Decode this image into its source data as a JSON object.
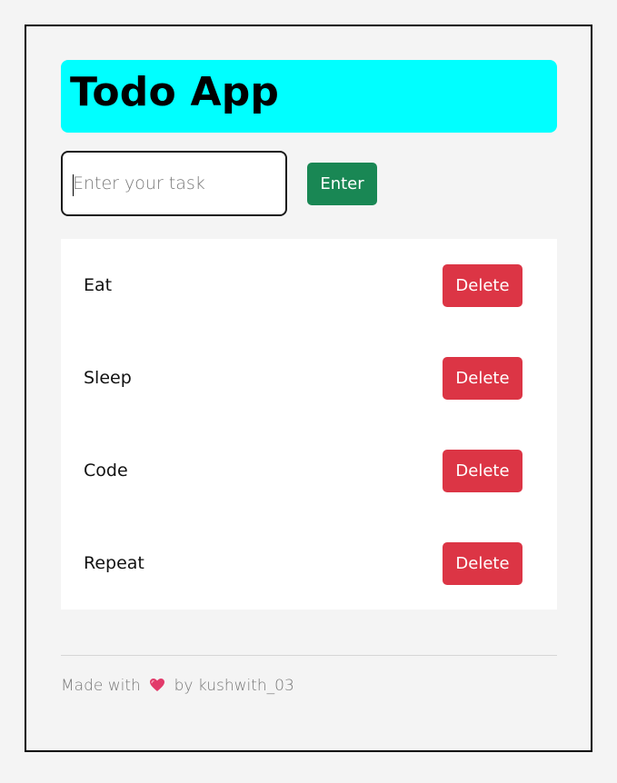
{
  "app": {
    "title": "Todo App"
  },
  "form": {
    "placeholder": "Enter your task",
    "value": "",
    "submit_label": "Enter"
  },
  "todos": [
    {
      "label": "Eat",
      "delete_label": "Delete"
    },
    {
      "label": "Sleep",
      "delete_label": "Delete"
    },
    {
      "label": "Code",
      "delete_label": "Delete"
    },
    {
      "label": "Repeat",
      "delete_label": "Delete"
    }
  ],
  "footer": {
    "prefix": "Made with",
    "icon": "heart-icon",
    "suffix": "by kushwith_03"
  },
  "colors": {
    "header_bg": "#00ffff",
    "enter_button": "#198754",
    "delete_button": "#dc3545",
    "heart": "#e23a6a"
  }
}
